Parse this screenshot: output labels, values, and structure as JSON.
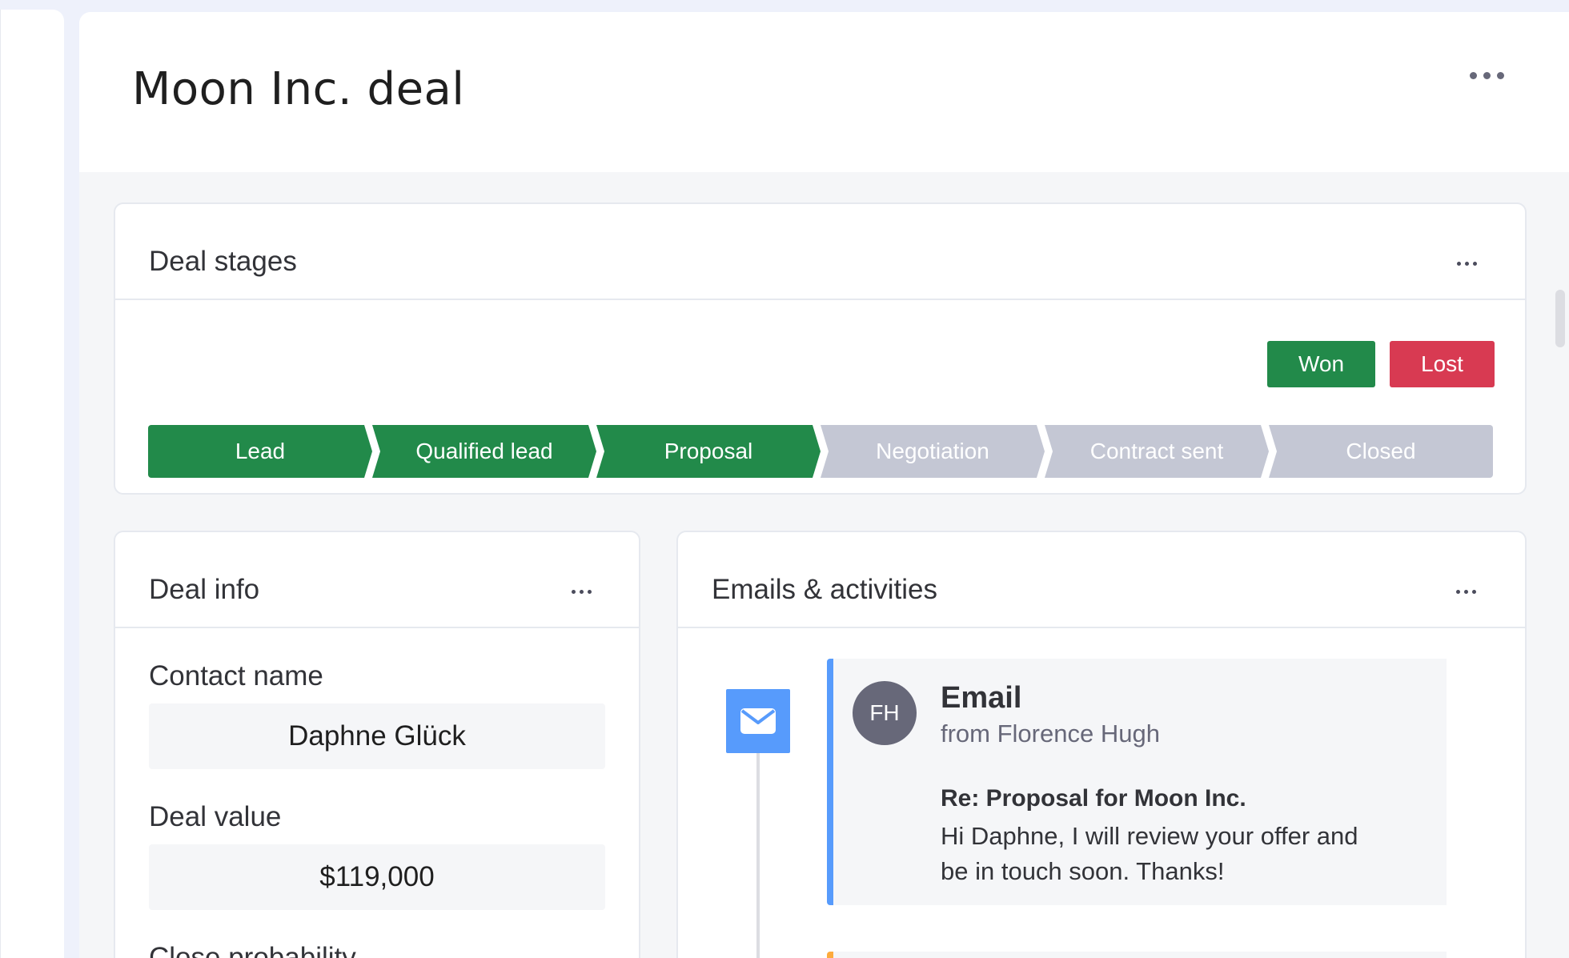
{
  "page": {
    "title": "Moon Inc. deal"
  },
  "deal_stages": {
    "title": "Deal stages",
    "won_label": "Won",
    "lost_label": "Lost",
    "stages": [
      {
        "label": "Lead",
        "status": "done"
      },
      {
        "label": "Qualified lead",
        "status": "done"
      },
      {
        "label": "Proposal",
        "status": "done"
      },
      {
        "label": "Negotiation",
        "status": "todo"
      },
      {
        "label": "Contract sent",
        "status": "todo"
      },
      {
        "label": "Closed",
        "status": "todo"
      }
    ]
  },
  "deal_info": {
    "title": "Deal info",
    "fields": [
      {
        "label": "Contact name",
        "value": "Daphne Glück"
      },
      {
        "label": "Deal value",
        "value": "$119,000"
      },
      {
        "label": "Close probability",
        "value": ""
      }
    ]
  },
  "activities": {
    "title": "Emails & activities",
    "items": [
      {
        "icon": "mail-icon",
        "avatar_initials": "FH",
        "type": "Email",
        "from": "from Florence Hugh",
        "subject": "Re: Proposal for Moon Inc.",
        "body": "Hi Daphne, I will review your offer and be in touch soon. Thanks!"
      }
    ]
  },
  "colors": {
    "done_stage": "#228a4a",
    "todo_stage": "#c4c7d4",
    "won": "#228a4a",
    "lost": "#d83a52",
    "email_accent": "#579bfc",
    "second_item_accent": "#fdab3d"
  }
}
